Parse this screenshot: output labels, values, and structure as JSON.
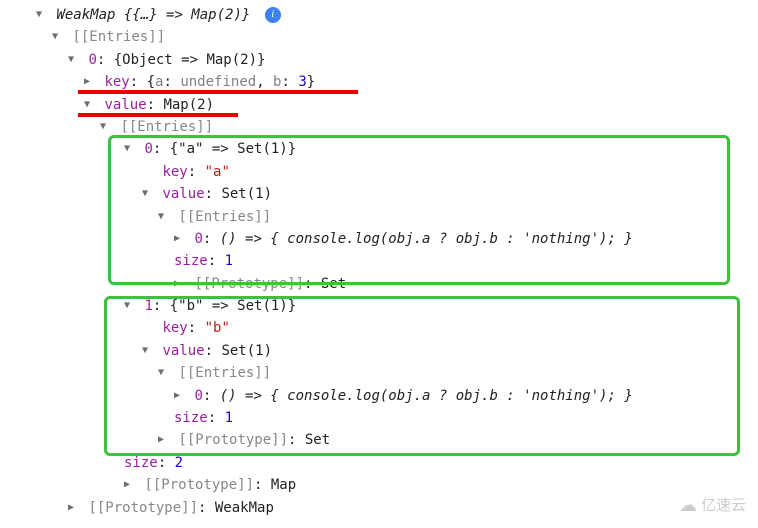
{
  "root": {
    "label": "WeakMap ",
    "summary": "{{…} => Map(2)}",
    "entries_label": "[[Entries]]",
    "proto_label": "[[Prototype]]",
    "proto_value": "WeakMap",
    "entry0": {
      "idx": "0",
      "summary": "{Object => Map(2)}",
      "key_label": "key",
      "key_open": "{",
      "key_a_prop": "a",
      "key_a_val": "undefined",
      "key_sep": ", ",
      "key_b_prop": "b",
      "key_b_val": "3",
      "key_close": "}",
      "value_label": "value",
      "value_summary": "Map(2)",
      "entries_label": "[[Entries]]",
      "size_label": "size",
      "size_value": "2",
      "proto_label": "[[Prototype]]",
      "proto_value": "Map",
      "e0": {
        "idx": "0",
        "summary": "{\"a\" => Set(1)}",
        "key_label": "key",
        "key_value": "\"a\"",
        "value_label": "value",
        "value_summary": "Set(1)",
        "entries_label": "[[Entries]]",
        "inner_idx": "0",
        "inner_fn": "() => { console.log(obj.a ? obj.b : 'nothing'); }",
        "size_label": "size",
        "size_value": "1",
        "proto_label": "[[Prototype]]",
        "proto_value": "Set"
      },
      "e1": {
        "idx": "1",
        "summary": "{\"b\" => Set(1)}",
        "key_label": "key",
        "key_value": "\"b\"",
        "value_label": "value",
        "value_summary": "Set(1)",
        "entries_label": "[[Entries]]",
        "inner_idx": "0",
        "inner_fn": "() => { console.log(obj.a ? obj.b : 'nothing'); }",
        "size_label": "size",
        "size_value": "1",
        "proto_label": "[[Prototype]]",
        "proto_value": "Set"
      }
    }
  },
  "watermark": "亿速云"
}
